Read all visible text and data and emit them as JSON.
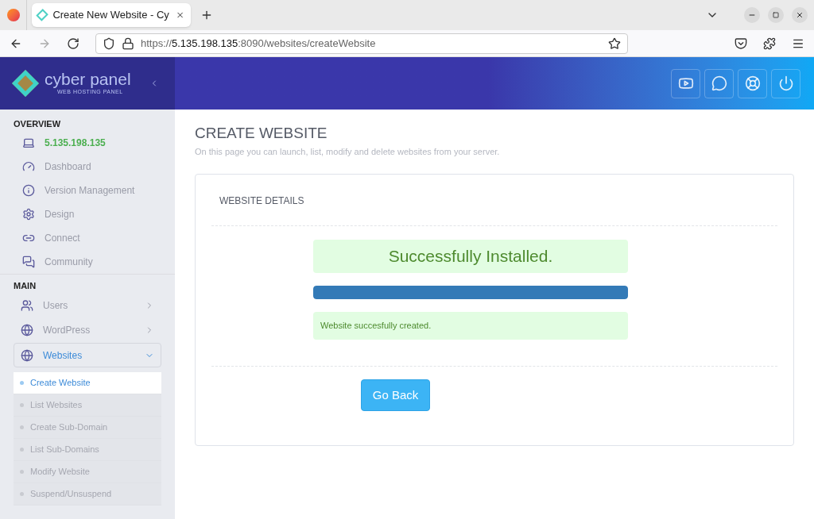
{
  "browser": {
    "tab_title": "Create New Website - Cy",
    "url": {
      "scheme": "https://",
      "host": "5.135.198.135",
      "path": ":8090/websites/createWebsite"
    }
  },
  "logo": {
    "name": "cyber panel",
    "tagline": "WEB HOSTING PANEL"
  },
  "sidebar": {
    "sections": [
      {
        "heading": "OVERVIEW",
        "items": [
          {
            "label": "5.135.198.135",
            "kind": "ip"
          },
          {
            "label": "Dashboard",
            "kind": "link"
          },
          {
            "label": "Version Management",
            "kind": "link"
          },
          {
            "label": "Design",
            "kind": "link"
          },
          {
            "label": "Connect",
            "kind": "link"
          },
          {
            "label": "Community",
            "kind": "link"
          }
        ]
      },
      {
        "heading": "MAIN",
        "items": [
          {
            "label": "Users",
            "kind": "menu",
            "expanded": false
          },
          {
            "label": "WordPress",
            "kind": "menu",
            "expanded": false
          },
          {
            "label": "Websites",
            "kind": "menu",
            "expanded": true,
            "children": [
              {
                "label": "Create Website",
                "selected": true
              },
              {
                "label": "List Websites",
                "selected": false
              },
              {
                "label": "Create Sub-Domain",
                "selected": false
              },
              {
                "label": "List Sub-Domains",
                "selected": false
              },
              {
                "label": "Modify Website",
                "selected": false
              },
              {
                "label": "Suspend/Unsuspend",
                "selected": false
              }
            ]
          }
        ]
      }
    ]
  },
  "page": {
    "title": "CREATE WEBSITE",
    "subtitle": "On this page you can launch, list, modify and delete websites from your server.",
    "card": {
      "heading": "WEBSITE DETAILS",
      "status": "Successfully Installed.",
      "progress": {
        "level": 1
      },
      "message": "Website succesfully created.",
      "button": "Go Back"
    }
  }
}
